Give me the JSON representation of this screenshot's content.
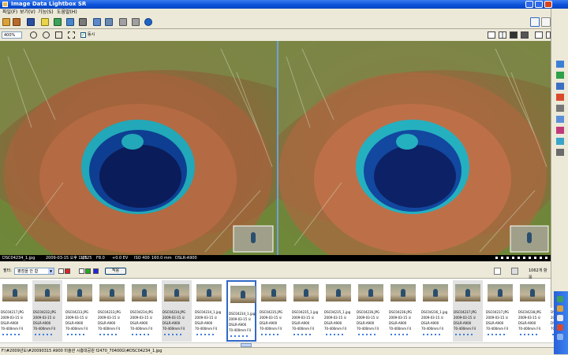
{
  "window": {
    "title": "Image Data Lightbox SR"
  },
  "menu": [
    {
      "label": "파일(F)"
    },
    {
      "label": "보기(V)"
    },
    {
      "label": "기능(S)"
    },
    {
      "label": "도움말(H)"
    }
  ],
  "toolbar": {
    "zoom_value": "400%",
    "sync_checkbox": {
      "checked": true,
      "label": "동시"
    }
  },
  "status": {
    "filename": "DSC04234_1.jpg",
    "date": "2009-03-15 오후 1:05",
    "shutter": "1/125",
    "aperture": "F8.0",
    "ev": "+0.0 EV",
    "iso": "ISO 400",
    "focal": "160.0 mm",
    "camera": "DSLR-A900"
  },
  "filter": {
    "label": "필터:",
    "combo_value": "평점을 안 함",
    "apply_label": "적용",
    "count_label": "1062개 항목"
  },
  "filmstrip": [
    {
      "name": "DSC04217.JPG",
      "date": "2009-03-15 오",
      "camera": "DSLR-A900",
      "lens": "70-400mm F4",
      "state": "normal"
    },
    {
      "name": "DSC04232.JPG",
      "date": "2009-03-15 오",
      "camera": "DSLR-A900",
      "lens": "70-400mm F4",
      "state": "grey"
    },
    {
      "name": "DSC04233.JPG",
      "date": "2009-03-15 오",
      "camera": "DSLR-A900",
      "lens": "70-400mm F4",
      "state": "normal"
    },
    {
      "name": "DSC04233.JPG",
      "date": "2009-03-15 오",
      "camera": "DSLR-A900",
      "lens": "70-400mm F4",
      "state": "normal"
    },
    {
      "name": "DSC04234.JPG",
      "date": "2009-03-15 오",
      "camera": "DSLR-A900",
      "lens": "70-400mm F4",
      "state": "normal"
    },
    {
      "name": "DSC04234.JPG",
      "date": "2009-03-15 오",
      "camera": "DSLR-A900",
      "lens": "70-400mm F4",
      "state": "grey"
    },
    {
      "name": "DSC04234_1.jpg",
      "date": "2009-03-15 오",
      "camera": "DSLR-A900",
      "lens": "70-400mm F4",
      "state": "normal"
    },
    {
      "name": "DSC04234_1.jpg",
      "date": "2009-03-15 오",
      "camera": "DSLR-A900",
      "lens": "70-400mm F4",
      "state": "selected"
    },
    {
      "name": "DSC04235.JPG",
      "date": "2009-03-15 오",
      "camera": "DSLR-A900",
      "lens": "70-400mm F4",
      "state": "normal"
    },
    {
      "name": "DSC04235_1.jpg",
      "date": "2009-03-15 오",
      "camera": "DSLR-A900",
      "lens": "70-400mm F4",
      "state": "normal"
    },
    {
      "name": "DSC04235_1.jpg",
      "date": "2009-03-15 오",
      "camera": "DSLR-A900",
      "lens": "70-400mm F4",
      "state": "normal"
    },
    {
      "name": "DSC04236.JPG",
      "date": "2009-03-15 오",
      "camera": "DSLR-A900",
      "lens": "70-400mm F4",
      "state": "normal"
    },
    {
      "name": "DSC04236.JPG",
      "date": "2009-03-15 오",
      "camera": "DSLR-A900",
      "lens": "70-400mm F4",
      "state": "normal"
    },
    {
      "name": "DSC04236_1.jpg",
      "date": "2009-03-15 오",
      "camera": "DSLR-A900",
      "lens": "70-400mm F4",
      "state": "normal"
    },
    {
      "name": "DSC04237.JPG",
      "date": "2009-03-15 오",
      "camera": "DSLR-A900",
      "lens": "70-400mm F4",
      "state": "grey"
    },
    {
      "name": "DSC04237.JPG",
      "date": "2009-03-15 오",
      "camera": "DSLR-A900",
      "lens": "70-400mm F4",
      "state": "normal"
    },
    {
      "name": "DSC04238.JPG",
      "date": "2009-03-15 오",
      "camera": "DSLR-A900",
      "lens": "70-400mm F4",
      "state": "normal"
    },
    {
      "name": "DSC04238.JPG",
      "date": "2009-03-15 오",
      "camera": "DSLR-A900",
      "lens": "70-400mm F4",
      "state": "normal"
    }
  ],
  "path": "F:\\#2009년도\\#20090315 A900 미술관 시흥대공원 f2470_70400G\\#DSC04234_1.jpg",
  "colors": {
    "accent": "#3169c6",
    "title_bar": "#0a50d8",
    "viewer_divider": "#6fa0d8"
  }
}
